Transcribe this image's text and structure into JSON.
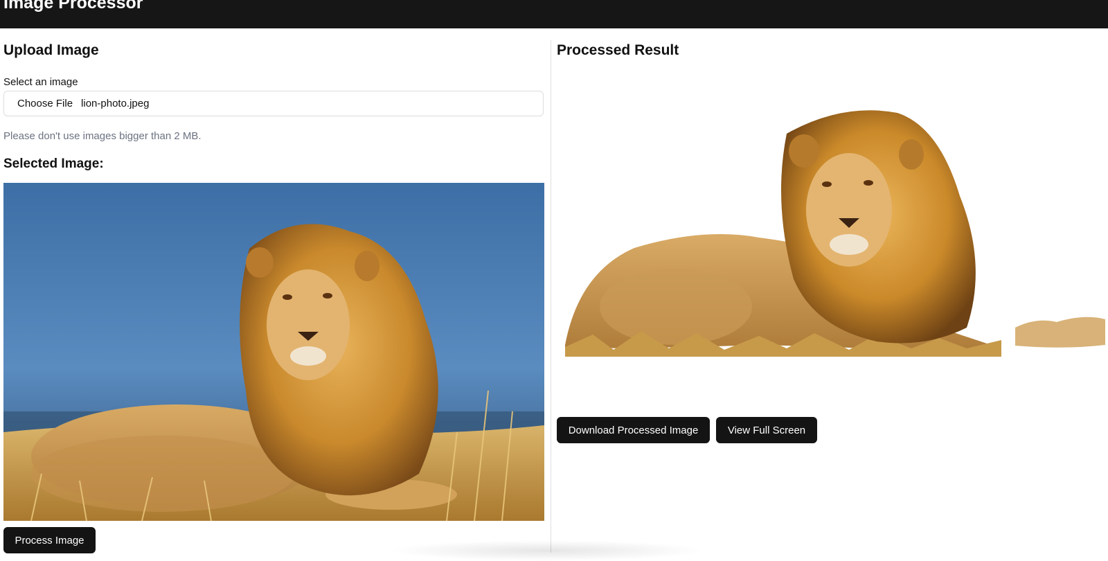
{
  "app": {
    "title": "Image Processor"
  },
  "upload": {
    "heading": "Upload Image",
    "field_label": "Select an image",
    "choose_button_label": "Choose File",
    "file_name": "lion-photo.jpeg",
    "hint": "Please don't use images bigger than 2 MB.",
    "selected_heading": "Selected Image:",
    "process_button_label": "Process Image"
  },
  "result": {
    "heading": "Processed Result",
    "download_button_label": "Download Processed Image",
    "fullscreen_button_label": "View Full Screen"
  },
  "colors": {
    "header_bg": "#161616",
    "button_bg": "#141414",
    "hint_text": "#6b7280",
    "sky": "#4a7eb5",
    "grass": "#c9a35a",
    "lion_mane": "#c98a2b",
    "lion_body": "#d6a55c"
  },
  "images": {
    "selected": "lion-on-savanna-photo",
    "processed": "lion-background-removed"
  }
}
